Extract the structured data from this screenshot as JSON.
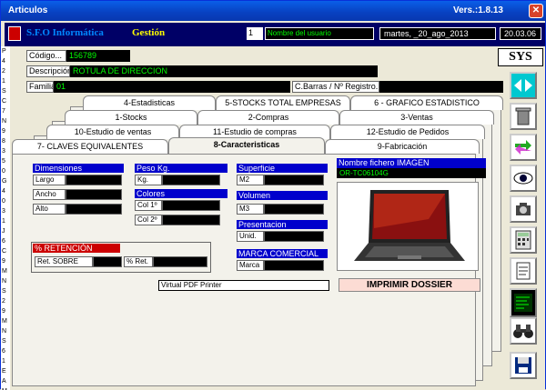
{
  "window": {
    "title": "Articulos",
    "version": "Vers.:1.8.13",
    "close_glyph": "✕"
  },
  "header": {
    "company": "S.F.O Informática",
    "module": "Gestión",
    "user_num": "1",
    "user_name": "Nombre del usuario",
    "date_text": "martes, _20_ago_2013",
    "time": "20.03.06"
  },
  "sys_label": "SYS",
  "form": {
    "codigo_label": "Código...",
    "codigo_value": "156789",
    "descripcion_label": "Descripción",
    "descripcion_value": "ROTULA DE DIRECCION",
    "familia_label": "Familia",
    "familia_value": "01",
    "cbarras_label": "C.Barras / Nº Registro..."
  },
  "tabs": {
    "row1": [
      "4-Estadisticas",
      "5-STOCKS TOTAL EMPRESAS",
      "6 - GRAFICO ESTADISTICO"
    ],
    "row2": [
      "1-Stocks",
      "2-Compras",
      "3-Ventas"
    ],
    "row3": [
      "10-Estudio de ventas",
      "11-Estudio de compras",
      "12-Estudio de Pedidos"
    ],
    "row4": [
      "7- CLAVES EQUIVALENTES",
      "8-Caracteristicas",
      "9-Fabricación"
    ]
  },
  "caracteristicas": {
    "dimensiones": "Dimensiones",
    "largo": "Largo",
    "ancho": "Ancho",
    "alto": "Alto",
    "peso": "Peso Kg.",
    "kg": "Kg.",
    "colores": "Colores",
    "col1": "Col 1º",
    "col2": "Col 2º",
    "superficie": "Superficie",
    "m2": "M2",
    "volumen": "Volumen",
    "m3": "M3",
    "presentacion": "Presentacion",
    "unid": "Unid.",
    "marca_comercial": "MARCA COMERCIAL",
    "marca": "Marca",
    "retencion": "% RETENCIÓN",
    "ret_sobre": "Ret. SOBRE",
    "ret_pct": "% Ret.",
    "fichero_label": "Nombre fichero IMAGEN",
    "fichero_value": "OR-TC06104G",
    "printer": "Virtual PDF Printer",
    "imprimir": "IMPRIMIR DOSSIER"
  },
  "left_strip": [
    "P",
    "4",
    "2",
    "1",
    "S",
    "C",
    "7",
    "N",
    "9",
    "8",
    "3",
    "5",
    "0",
    "G",
    "4",
    "0",
    "3",
    "1",
    "J",
    "6",
    "C",
    "9",
    "M",
    "N",
    "S",
    "2",
    "9",
    "M",
    "N",
    "S",
    "6",
    "1",
    "E",
    "A",
    "M"
  ]
}
